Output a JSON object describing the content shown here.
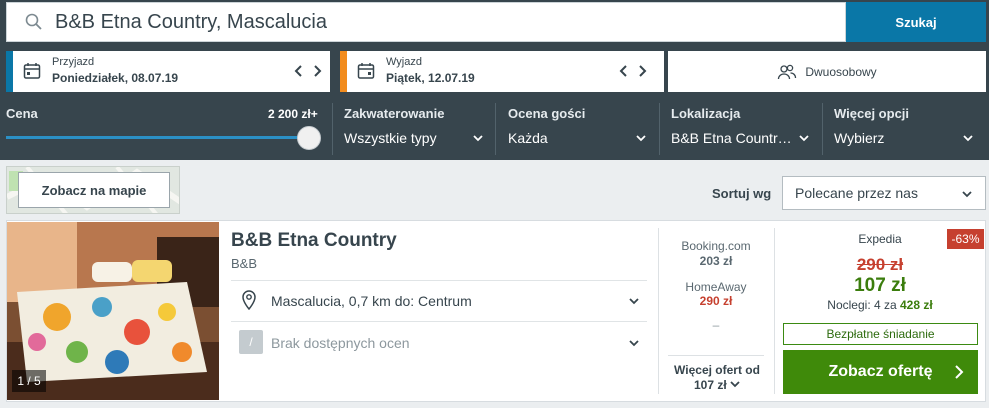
{
  "search": {
    "value": "B&B Etna Country, Mascalucia",
    "button": "Szukaj"
  },
  "checkin": {
    "label": "Przyjazd",
    "date": "Poniedziałek, 08.07.19"
  },
  "checkout": {
    "label": "Wyjazd",
    "date": "Piątek, 12.07.19"
  },
  "rooms": {
    "label": "Dwuosobowy"
  },
  "filters": {
    "price": {
      "label": "Cena",
      "max": "2 200 zł+"
    },
    "accommodation": {
      "label": "Zakwaterowanie",
      "value": "Wszystkie typy"
    },
    "rating": {
      "label": "Ocena gości",
      "value": "Każda"
    },
    "location": {
      "label": "Lokalizacja",
      "value": "B&B Etna Countr…"
    },
    "more": {
      "label": "Więcej opcji",
      "value": "Wybierz"
    }
  },
  "map": {
    "button": "Zobacz na mapie"
  },
  "sort": {
    "label": "Sortuj wg",
    "value": "Polecane przez nas"
  },
  "result": {
    "photo_counter": "1 / 5",
    "name": "B&B Etna Country",
    "type": "B&B",
    "location": "Mascalucia, 0,7 km do: Centrum",
    "rating_icon": "/",
    "no_reviews": "Brak dostępnych ocen",
    "providers": [
      {
        "name": "Booking.com",
        "price": "203 zł"
      },
      {
        "name": "HomeAway",
        "price": "290 zł"
      }
    ],
    "dash": "–",
    "more_offers_line1": "Więcej ofert od",
    "more_offers_line2": "107 zł",
    "best": {
      "provider": "Expedia",
      "discount": "-63%",
      "old_price": "290 zł",
      "price": "107 zł",
      "nights_prefix": "Noclegi: 4 za ",
      "nights_total": "428 zł",
      "breakfast": "Bezpłatne śniadanie",
      "cta": "Zobacz ofertę"
    }
  },
  "colors": {
    "header": "#37454d",
    "search_button": "#0a77a7",
    "checkin_accent": "#0a77a7",
    "checkout_accent": "#f28c1e",
    "cta": "#3f8a0a",
    "discount": "#c6402f"
  }
}
